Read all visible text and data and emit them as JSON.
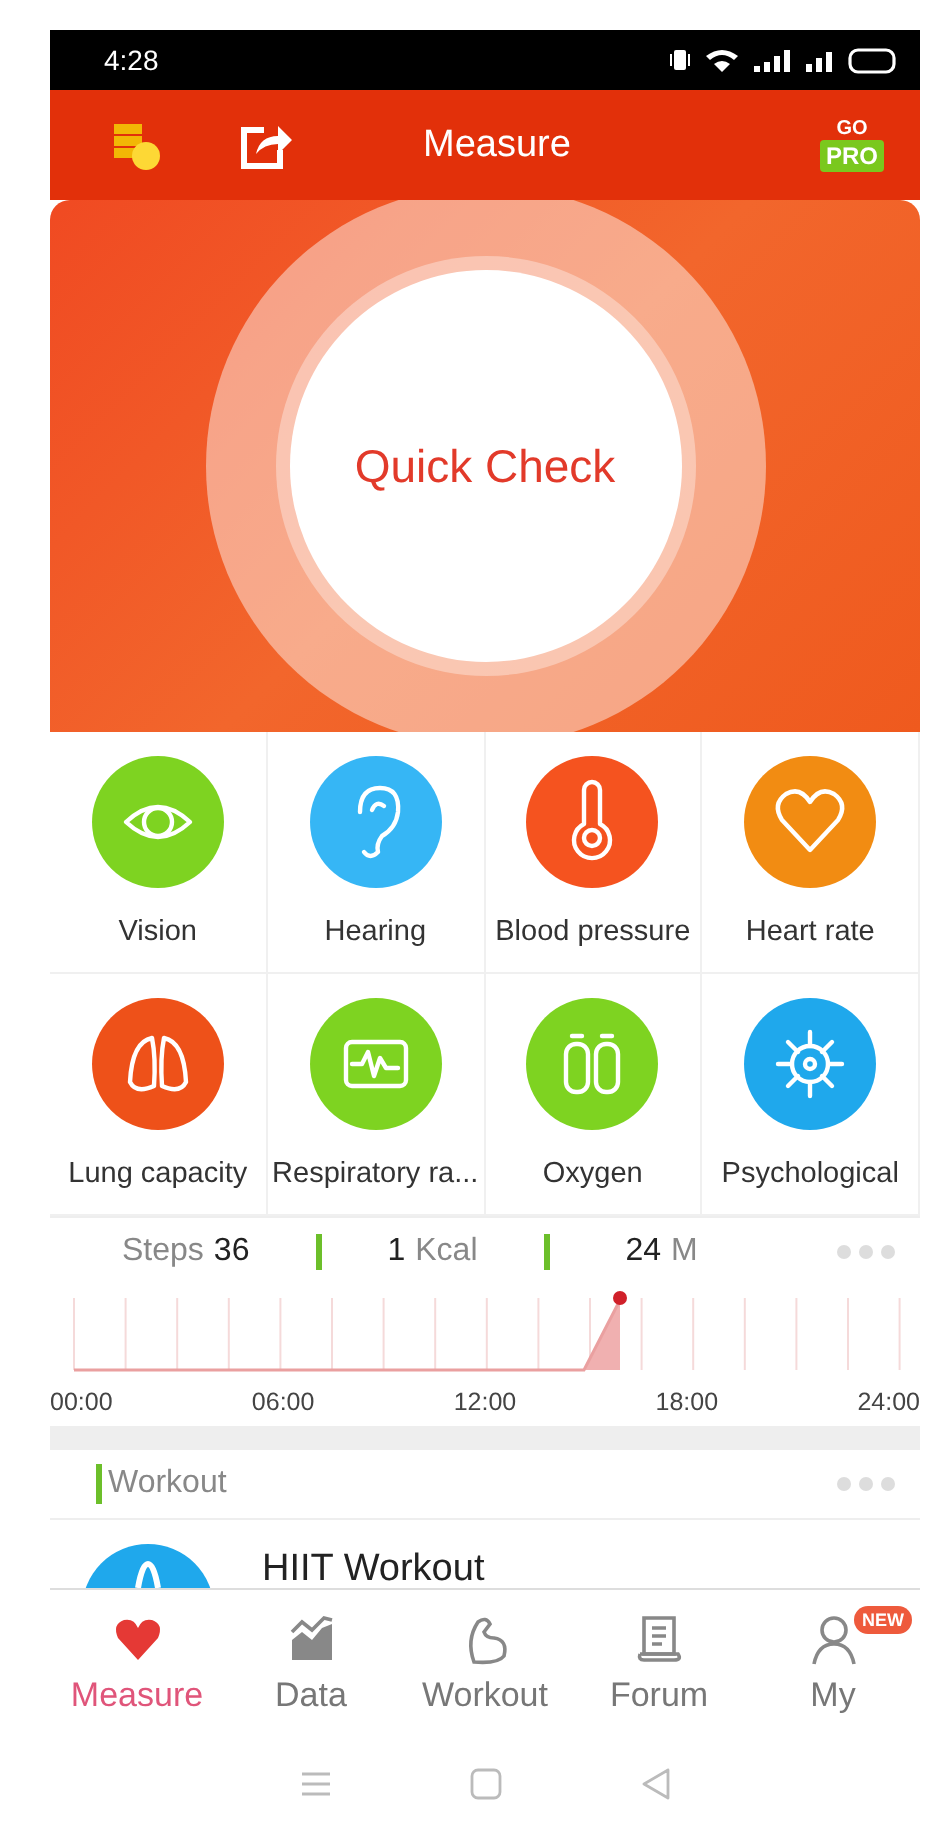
{
  "status_bar": {
    "time": "4:28"
  },
  "header": {
    "title": "Measure",
    "pro_badge": {
      "top": "GO",
      "label": "PRO"
    }
  },
  "hero": {
    "button": "Quick Check"
  },
  "tests": [
    {
      "label": "Vision",
      "kind": "eye",
      "color": "#7ed321"
    },
    {
      "label": "Hearing",
      "kind": "ear",
      "color": "#36b6f5"
    },
    {
      "label": "Blood pressure",
      "kind": "thermometer",
      "color": "#f5531f"
    },
    {
      "label": "Heart rate",
      "kind": "heart",
      "color": "#f28c12"
    },
    {
      "label": "Lung capacity",
      "kind": "lungs",
      "color": "#ee5119"
    },
    {
      "label": "Respiratory ra...",
      "kind": "monitor",
      "color": "#7ed321"
    },
    {
      "label": "Oxygen",
      "kind": "tanks",
      "color": "#7ed321"
    },
    {
      "label": "Psychological",
      "kind": "gear",
      "color": "#1fa8ec"
    }
  ],
  "activity": {
    "steps_label": "Steps",
    "steps": "36",
    "kcal": "1",
    "kcal_unit": "Kcal",
    "minutes": "24",
    "minutes_unit": "M"
  },
  "timeline": {
    "labels": [
      "00:00",
      "06:00",
      "12:00",
      "18:00",
      "24:00"
    ]
  },
  "workout": {
    "title": "Workout",
    "items": [
      {
        "title": "HIIT Workout"
      }
    ]
  },
  "tabs": [
    {
      "label": "Measure",
      "kind": "heart",
      "selected": true
    },
    {
      "label": "Data",
      "kind": "chart",
      "selected": false
    },
    {
      "label": "Workout",
      "kind": "arm",
      "selected": false
    },
    {
      "label": "Forum",
      "kind": "scroll",
      "selected": false
    },
    {
      "label": "My",
      "kind": "person",
      "selected": false,
      "badge": "NEW"
    }
  ]
}
